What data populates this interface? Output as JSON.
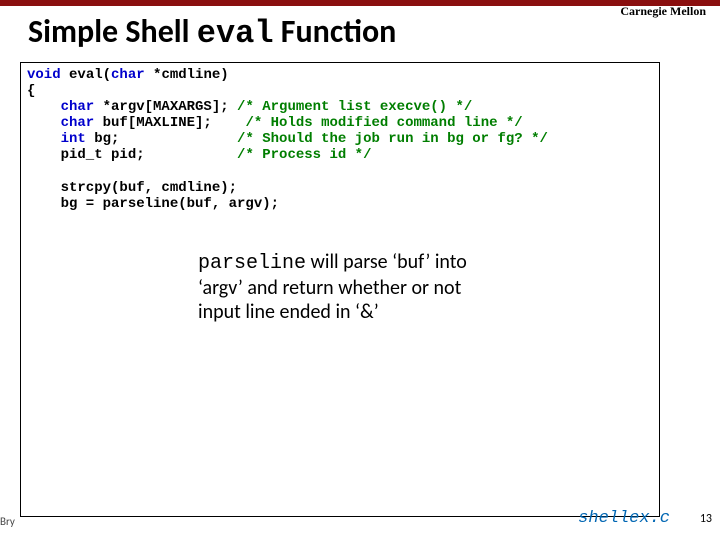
{
  "affiliation": "Carnegie Mellon",
  "title": {
    "pre": "Simple Shell ",
    "code": "eval",
    "post": " Function"
  },
  "code": {
    "l1_a": "void",
    "l1_b": " eval(",
    "l1_c": "char",
    "l1_d": " *cmdline)",
    "l2": "{",
    "l3_a": "    char",
    "l3_b": " *argv[MAXARGS]; ",
    "l3_c": "/* Argument list execve() */",
    "l4_a": "    char",
    "l4_b": " buf[MAXLINE];    ",
    "l4_c": "/* Holds modified command line */",
    "l5_a": "    int",
    "l5_b": " bg;              ",
    "l5_c": "/* Should the job run in bg or fg? */",
    "l6_a": "    pid_t",
    "l6_b": " pid;           ",
    "l6_c": "/* Process id */",
    "l7": "",
    "l8": "    strcpy(buf, cmdline);",
    "l9": "    bg = parseline(buf, argv);"
  },
  "callout": {
    "t1a": "parseline",
    "t1b": " will parse ‘buf’ into ‘argv’ and return whether or not input line ended in ‘&’"
  },
  "filename": "shellex.c",
  "pagenum": "13",
  "author_crop": "Bry"
}
